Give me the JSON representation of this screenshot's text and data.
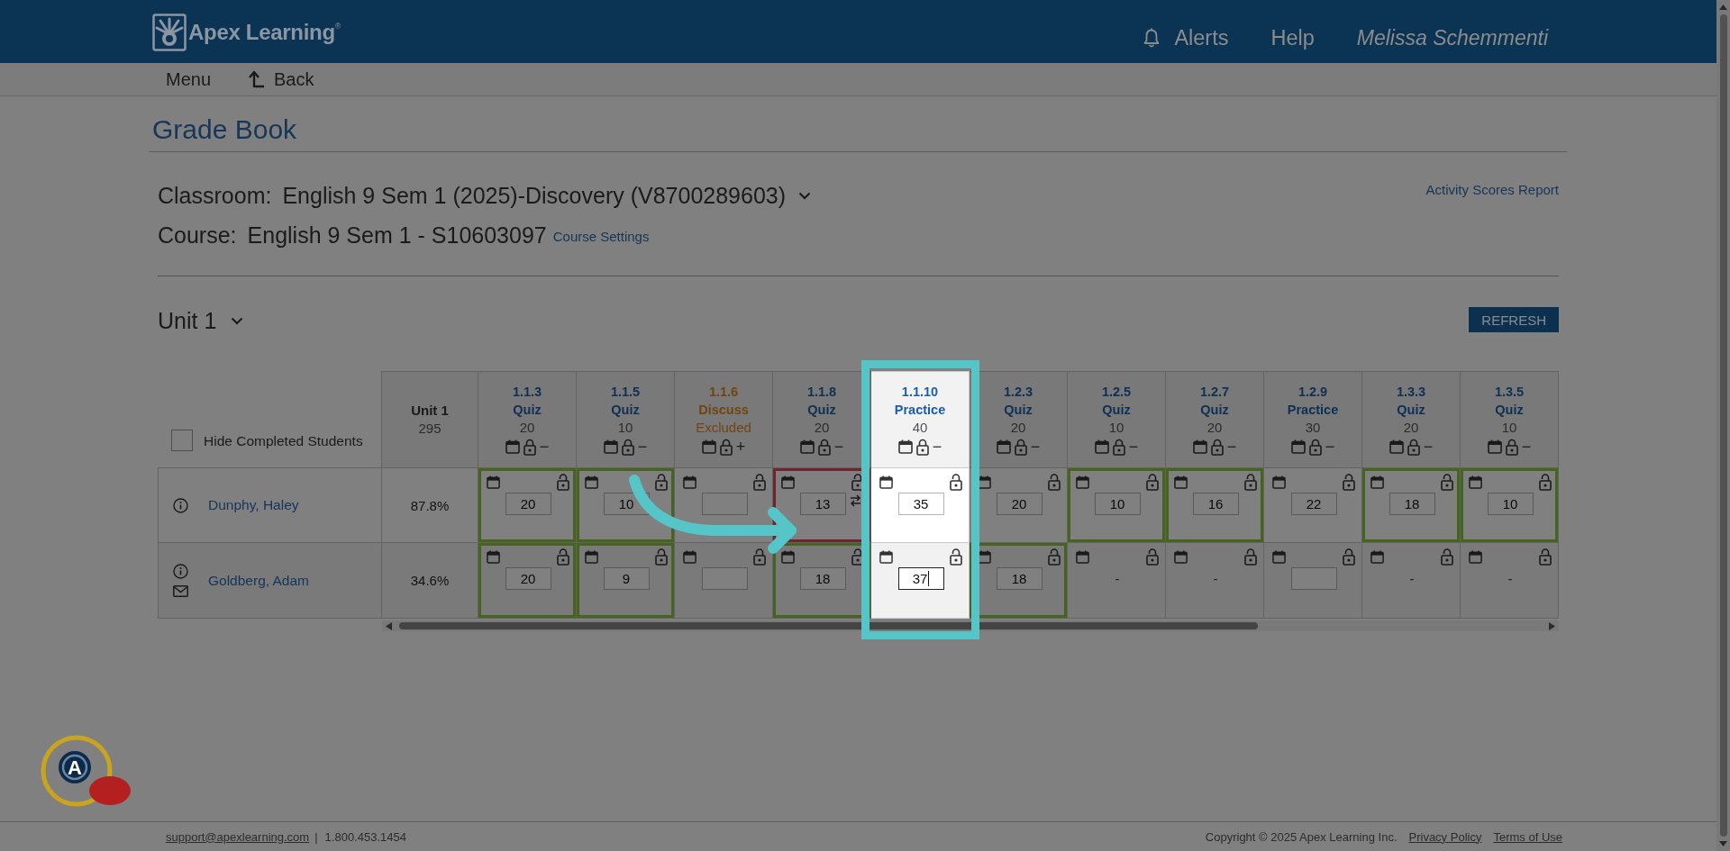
{
  "header": {
    "logo_text": "Apex Learning$^{®}$",
    "links": [
      {
        "label": "Alerts",
        "kind": "alerts"
      },
      {
        "label": "Help",
        "kind": "help"
      }
    ],
    "user_name": "Melissa Schemmenti"
  },
  "nav": [
    {
      "label": "Menu",
      "kind": "menu"
    },
    {
      "label": "Back",
      "kind": "back"
    }
  ],
  "page_title": "Grade Book",
  "classroom": {
    "label": "Classroom:",
    "value": "English 9 Sem 1 (2025)-Discovery (V8700289603)"
  },
  "course": {
    "label": "Course:",
    "value": "English 9 Sem 1 - S10603097",
    "settings_link": "Course Settings"
  },
  "report_link": "Activity Scores Report",
  "unit": {
    "select": "Unit 1",
    "refresh_button": "REFRESH"
  },
  "table": {
    "hide_completed": {
      "label": "Hide Completed Students",
      "checked": false
    },
    "summary_column": {
      "title": "Unit 1",
      "points": "295"
    },
    "columns": [
      {
        "number": "1.1.3",
        "type": "Quiz",
        "points": "20",
        "toggle": "−",
        "excluded": false,
        "highlighted": false
      },
      {
        "number": "1.1.5",
        "type": "Quiz",
        "points": "10",
        "toggle": "−",
        "excluded": false,
        "highlighted": false
      },
      {
        "number": "1.1.6",
        "type": "Discuss",
        "points": "Excluded",
        "toggle": "+",
        "excluded": true,
        "highlighted": false
      },
      {
        "number": "1.1.8",
        "type": "Quiz",
        "points": "20",
        "toggle": "−",
        "excluded": false,
        "highlighted": false
      },
      {
        "number": "1.1.10",
        "type": "Practice",
        "points": "40",
        "toggle": "−",
        "excluded": false,
        "highlighted": true
      },
      {
        "number": "1.2.3",
        "type": "Quiz",
        "points": "20",
        "toggle": "−",
        "excluded": false,
        "highlighted": false
      },
      {
        "number": "1.2.5",
        "type": "Quiz",
        "points": "10",
        "toggle": "−",
        "excluded": false,
        "highlighted": false
      },
      {
        "number": "1.2.7",
        "type": "Quiz",
        "points": "20",
        "toggle": "−",
        "excluded": false,
        "highlighted": false
      },
      {
        "number": "1.2.9",
        "type": "Practice",
        "points": "30",
        "toggle": "−",
        "excluded": false,
        "highlighted": false
      },
      {
        "number": "1.3.3",
        "type": "Quiz",
        "points": "20",
        "toggle": "−",
        "excluded": false,
        "highlighted": false
      },
      {
        "number": "1.3.5",
        "type": "Quiz",
        "points": "10",
        "toggle": "−",
        "excluded": false,
        "highlighted": false
      }
    ],
    "rows": [
      {
        "name": "Dunphy, Haley",
        "mail_icon": false,
        "score": "87.8%",
        "cells": [
          {
            "kind": "input",
            "value": "20",
            "color": "#46631f",
            "focused": false,
            "swap_icon": false
          },
          {
            "kind": "input",
            "value": "10",
            "color": "#46631f",
            "focused": false,
            "swap_icon": false
          },
          {
            "kind": "input",
            "focused": false,
            "swap_icon": false
          },
          {
            "kind": "input",
            "value": "13",
            "color": "#6e252e",
            "focused": false,
            "swap_icon": true
          },
          {
            "kind": "input",
            "value": "35",
            "focused": false,
            "swap_icon": false
          },
          {
            "kind": "input",
            "value": "20",
            "focused": false,
            "swap_icon": false
          },
          {
            "kind": "input",
            "value": "10",
            "color": "#46631f",
            "focused": false,
            "swap_icon": false
          },
          {
            "kind": "input",
            "value": "16",
            "color": "#46631f",
            "focused": false,
            "swap_icon": false
          },
          {
            "kind": "input",
            "value": "22",
            "focused": false,
            "swap_icon": false
          },
          {
            "kind": "input",
            "value": "18",
            "color": "#46631f",
            "focused": false,
            "swap_icon": false
          },
          {
            "kind": "input",
            "value": "10",
            "color": "#46631f",
            "focused": false,
            "swap_icon": false
          }
        ]
      },
      {
        "name": "Goldberg, Adam",
        "mail_icon": true,
        "score": "34.6%",
        "cells": [
          {
            "kind": "input",
            "value": "20",
            "color": "#46631f",
            "focused": false,
            "swap_icon": false
          },
          {
            "kind": "input",
            "value": "9",
            "color": "#46631f",
            "focused": false,
            "swap_icon": false
          },
          {
            "kind": "input",
            "focused": false,
            "swap_icon": false
          },
          {
            "kind": "input",
            "value": "18",
            "color": "#46631f",
            "focused": false,
            "swap_icon": false
          },
          {
            "kind": "input",
            "value": "37",
            "focused": true,
            "swap_icon": false
          },
          {
            "kind": "input",
            "value": "18",
            "color": "#46631f",
            "focused": false,
            "swap_icon": false
          },
          {
            "kind": "dash",
            "text": "-",
            "swap_icon": false
          },
          {
            "kind": "dash",
            "text": "-",
            "swap_icon": false
          },
          {
            "kind": "input",
            "focused": false,
            "swap_icon": false
          },
          {
            "kind": "dash",
            "text": "-",
            "swap_icon": false
          },
          {
            "kind": "dash",
            "text": "-",
            "swap_icon": false
          }
        ]
      }
    ]
  },
  "footer": {
    "email": "support@apexlearning.com",
    "separator": "|",
    "phone": "1.800.453.1454",
    "copyright": "Copyright © 2025 Apex Learning Inc.",
    "links": [
      "Privacy Policy",
      "Terms of Use"
    ]
  },
  "badge": {
    "letter": "A"
  }
}
